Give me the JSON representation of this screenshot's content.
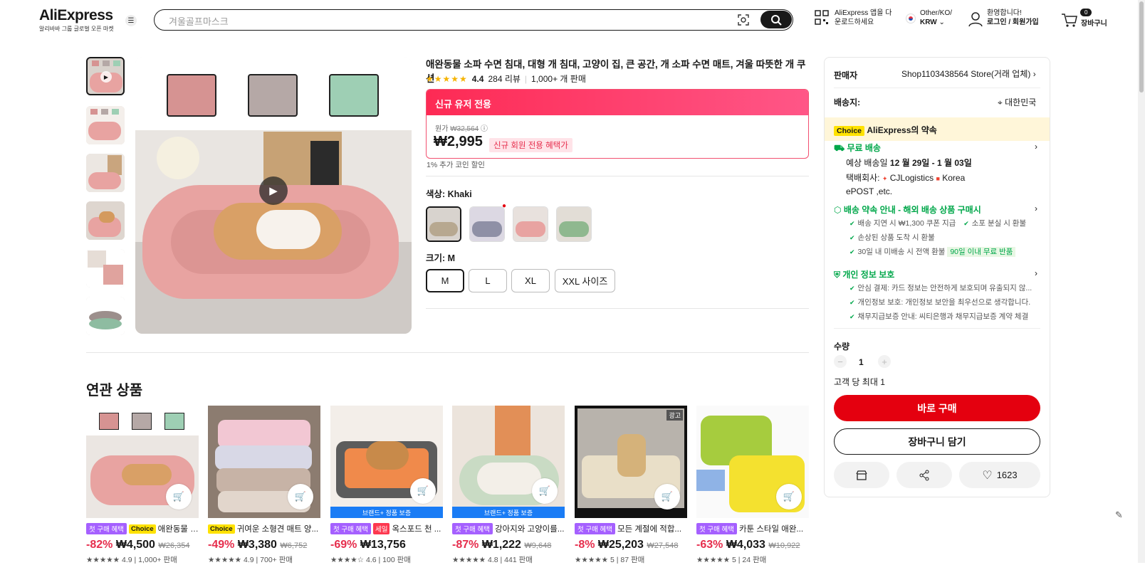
{
  "header": {
    "logo": "AliExpress",
    "logo_sub": "알리바바 그룹 글로벌 오픈 마켓",
    "search_placeholder": "겨울골프마스크",
    "app_line1": "AliExpress 앱을 다",
    "app_line2": "운로드하세요",
    "region_line1": "Other/KO/",
    "region_line2": "KRW",
    "welcome": "환영합니다!",
    "login": "로그인 / 회원가입",
    "cart_count": "0",
    "cart_label": "장바구니"
  },
  "product": {
    "title": "애완동물 소파 수면 침대, 대형 개 침대, 고양이 집, 큰 공간, 개 소파 수면 매트, 겨울 따뜻한 개 쿠션",
    "rating": "4.4",
    "rating_fraction": 0.88,
    "reviews": "284 리뷰",
    "sold": "1,000+ 개 판매",
    "promo_band": "신규 유저 전용",
    "orig_label": "원가",
    "orig_price": "₩32,564",
    "price": "₩2,995",
    "new_badge": "신규 회원 전용 혜택가",
    "coin": "1% 추가 코인 할인",
    "color_label": "색상: Khaki",
    "size_label": "크기: M",
    "sizes": [
      "M",
      "L",
      "XL",
      "XXL 사이즈"
    ],
    "selected_size": "M",
    "colors": {
      "pink": "#d69392",
      "taupe": "#b5a8a6",
      "mint": "#9ecfb4",
      "bed_pink": "#e8a3a1",
      "accent": "#e4000f"
    }
  },
  "panel": {
    "seller_label": "판매자",
    "seller_name": "Shop1103438564 Store(거래 업체)",
    "ship_to_label": "배송지:",
    "ship_to": "대한민국",
    "choice_tag": "Choice",
    "choice_text": "AliExpress의 약속",
    "free_ship": "무료 배송",
    "delivery_prefix": "예상 배송일",
    "delivery_dates": "12 월 29일 - 1 월 03일",
    "carrier_prefix": "택배회사:",
    "carrier1": "CJLogistics",
    "carrier2": "Korea",
    "carrier3": "ePOST ,etc.",
    "promise_title": "배송 약속 안내 - 해외 배송 상품 구매시",
    "promise1": "배송 지연 시 ₩1,300 쿠폰 지급",
    "promise2": "소포 분실 시 환불",
    "promise3": "손상된 상품 도착 시 환불",
    "promise4": "30일 내 미배송 시 전액 환불",
    "promise_badge": "90일 이내 무료 반품",
    "privacy_title": "개인 정보 보호",
    "privacy1": "안심 결제: 카드 정보는 안전하게 보호되며 유출되지 않...",
    "privacy2": "개인정보 보호: 개인정보 보안을 최우선으로 생각합니다.",
    "privacy3": "채무지급보증 안내: 씨티은행과 채무지급보증 계약 체결",
    "qty_label": "수량",
    "qty": "1",
    "max_per": "고객 당 최대 1",
    "buy_now": "바로 구매",
    "add_cart": "장바구니 담기",
    "wish_count": "1623"
  },
  "related": {
    "title": "연관 상품",
    "items": [
      {
        "tags": [
          "첫 구매 혜택",
          "Choice"
        ],
        "name": "애완동물 소...",
        "discount": "-82%",
        "price": "₩4,500",
        "orig": "₩26,354",
        "meta": "4.9 | 1,000+ 판매"
      },
      {
        "tags": [
          "Choice"
        ],
        "name": "귀여운 소형견 매트 양...",
        "discount": "-49%",
        "price": "₩3,380",
        "orig": "₩6,752",
        "meta": "4.9 | 700+ 판매"
      },
      {
        "tags": [
          "첫 구매 혜택",
          "세일"
        ],
        "name": "옥스포드 천 ...",
        "discount": "-69%",
        "price": "₩13,756",
        "orig": "",
        "meta": "4.6 | 100 판매",
        "band": "브랜드+ 정품 보증"
      },
      {
        "tags": [
          "첫 구매 혜택"
        ],
        "name": "강아지와 고양이를...",
        "discount": "-87%",
        "price": "₩1,222",
        "orig": "₩9,648",
        "meta": "4.8 | 441 판매",
        "band": "브랜드+ 정품 보증"
      },
      {
        "tags": [
          "첫 구매 혜택"
        ],
        "name": "모든 계절에 적합...",
        "discount": "-8%",
        "price": "₩25,203",
        "orig": "₩27,548",
        "meta": "5 | 87 판매",
        "ad": "광고"
      },
      {
        "tags": [
          "첫 구매 혜택"
        ],
        "name": "카툰 스타일 애완...",
        "discount": "-63%",
        "price": "₩4,033",
        "orig": "₩10,922",
        "meta": "5 | 24 판매"
      }
    ]
  }
}
